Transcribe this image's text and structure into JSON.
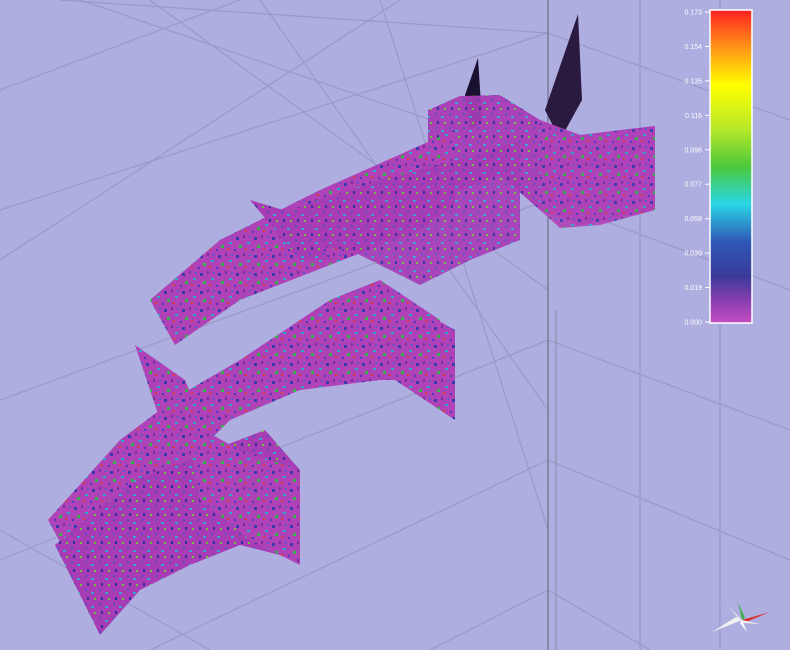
{
  "colorbar": {
    "ticks": [
      "0.173",
      "0.154",
      "0.135",
      "0.116",
      "0.096",
      "0.077",
      "0.058",
      "0.039",
      "0.019",
      "0.000"
    ],
    "stops": [
      "#ff2020",
      "#ff8c1a",
      "#ffff00",
      "#b7e82a",
      "#4cc93a",
      "#29d6e6",
      "#2f57b5",
      "#3a3a9a",
      "#8a3fb0",
      "#c44cc0"
    ]
  },
  "colors": {
    "background": "#aeaee0",
    "grid": "#9a9ac8",
    "surface_base": "#b042b8",
    "surface_dark": "#7a2a92"
  },
  "icons": {
    "orientation": "compass-orientation-icon"
  }
}
